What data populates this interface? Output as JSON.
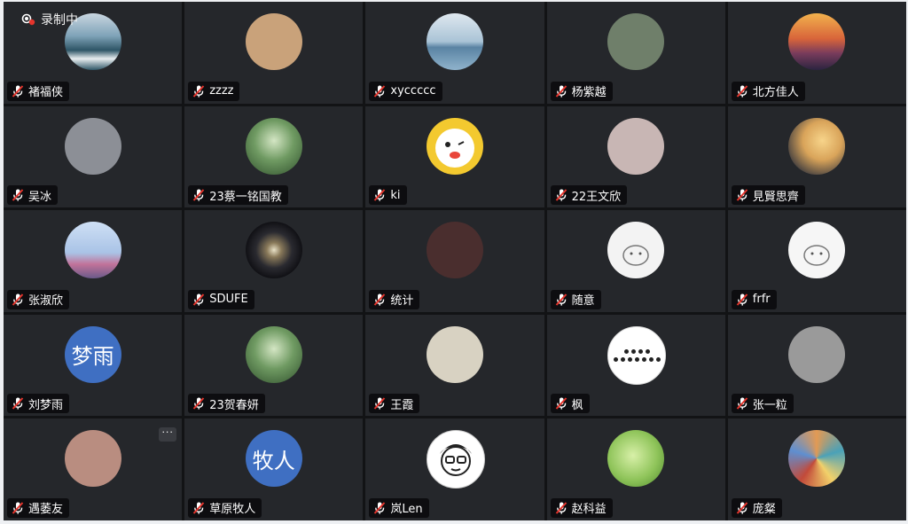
{
  "recording": {
    "label": "录制中"
  },
  "more_label": "···",
  "participants": [
    {
      "name": "褚福侠",
      "avatar": "photo-ocean-waves-icon",
      "bg": "#7fa3b8"
    },
    {
      "name": "zzzz",
      "avatar": "anime-girl-icon",
      "bg": "#c9a27a"
    },
    {
      "name": "xyccccc",
      "avatar": "photo-lighthouse-sea-icon",
      "bg": "#8fb3cc"
    },
    {
      "name": "杨紫越",
      "avatar": "photo-woman-portrait-icon",
      "bg": "#6f7f6a"
    },
    {
      "name": "北方佳人",
      "avatar": "photo-sunset-icon",
      "bg": "#c76a3e"
    },
    {
      "name": "吴冰",
      "avatar": "photo-people-room-icon",
      "bg": "#8c8f96"
    },
    {
      "name": "23蔡一铭国教",
      "avatar": "photo-forest-valley-icon",
      "bg": "#4f7a48"
    },
    {
      "name": "ki",
      "avatar": "cartoon-face-icon",
      "bg": "#f3c92f"
    },
    {
      "name": "22王文欣",
      "avatar": "photo-girl-portrait-icon",
      "bg": "#c8b6b4"
    },
    {
      "name": "見賢思齊",
      "avatar": "photo-sailing-ship-icon",
      "bg": "#d9a45a"
    },
    {
      "name": "张淑欣",
      "avatar": "photo-castle-icon",
      "bg": "#a9c3e6"
    },
    {
      "name": "SDUFE",
      "avatar": "galaxy-icon",
      "bg": "#1a1a1e"
    },
    {
      "name": "统计",
      "avatar": "photo-dark-figure-icon",
      "bg": "#4a2e2e"
    },
    {
      "name": "随意",
      "avatar": "cartoon-mouse-icon",
      "bg": "#f3f3f3"
    },
    {
      "name": "frfr",
      "avatar": "doodle-bun-icon",
      "bg": "#f6f6f6"
    },
    {
      "name": "刘梦雨",
      "avatar": "text-avatar",
      "avatar_text": "梦雨",
      "bg": "#3f6fc2"
    },
    {
      "name": "23贺春妍",
      "avatar": "photo-green-landscape-icon",
      "bg": "#6f9a62"
    },
    {
      "name": "王霞",
      "avatar": "cartoon-group-icon",
      "bg": "#d8d2c2"
    },
    {
      "name": "枫",
      "avatar": "dots-pattern-icon",
      "bg": "#ffffff"
    },
    {
      "name": "张一粒",
      "avatar": "photo-old-man-icon",
      "bg": "#9a9a9a"
    },
    {
      "name": "遇萎友",
      "avatar": "photo-pig-icon",
      "bg": "#b98d80",
      "more": true
    },
    {
      "name": "草原牧人",
      "avatar": "text-avatar",
      "avatar_text": "牧人",
      "bg": "#3f6fc2"
    },
    {
      "name": "岚Len",
      "avatar": "cartoon-glasses-man-icon",
      "bg": "#ffffff"
    },
    {
      "name": "赵科益",
      "avatar": "photo-green-apple-icon",
      "bg": "#8fc45a"
    },
    {
      "name": "庞粲",
      "avatar": "painting-colorful-icon",
      "bg": "#e29a54"
    }
  ]
}
